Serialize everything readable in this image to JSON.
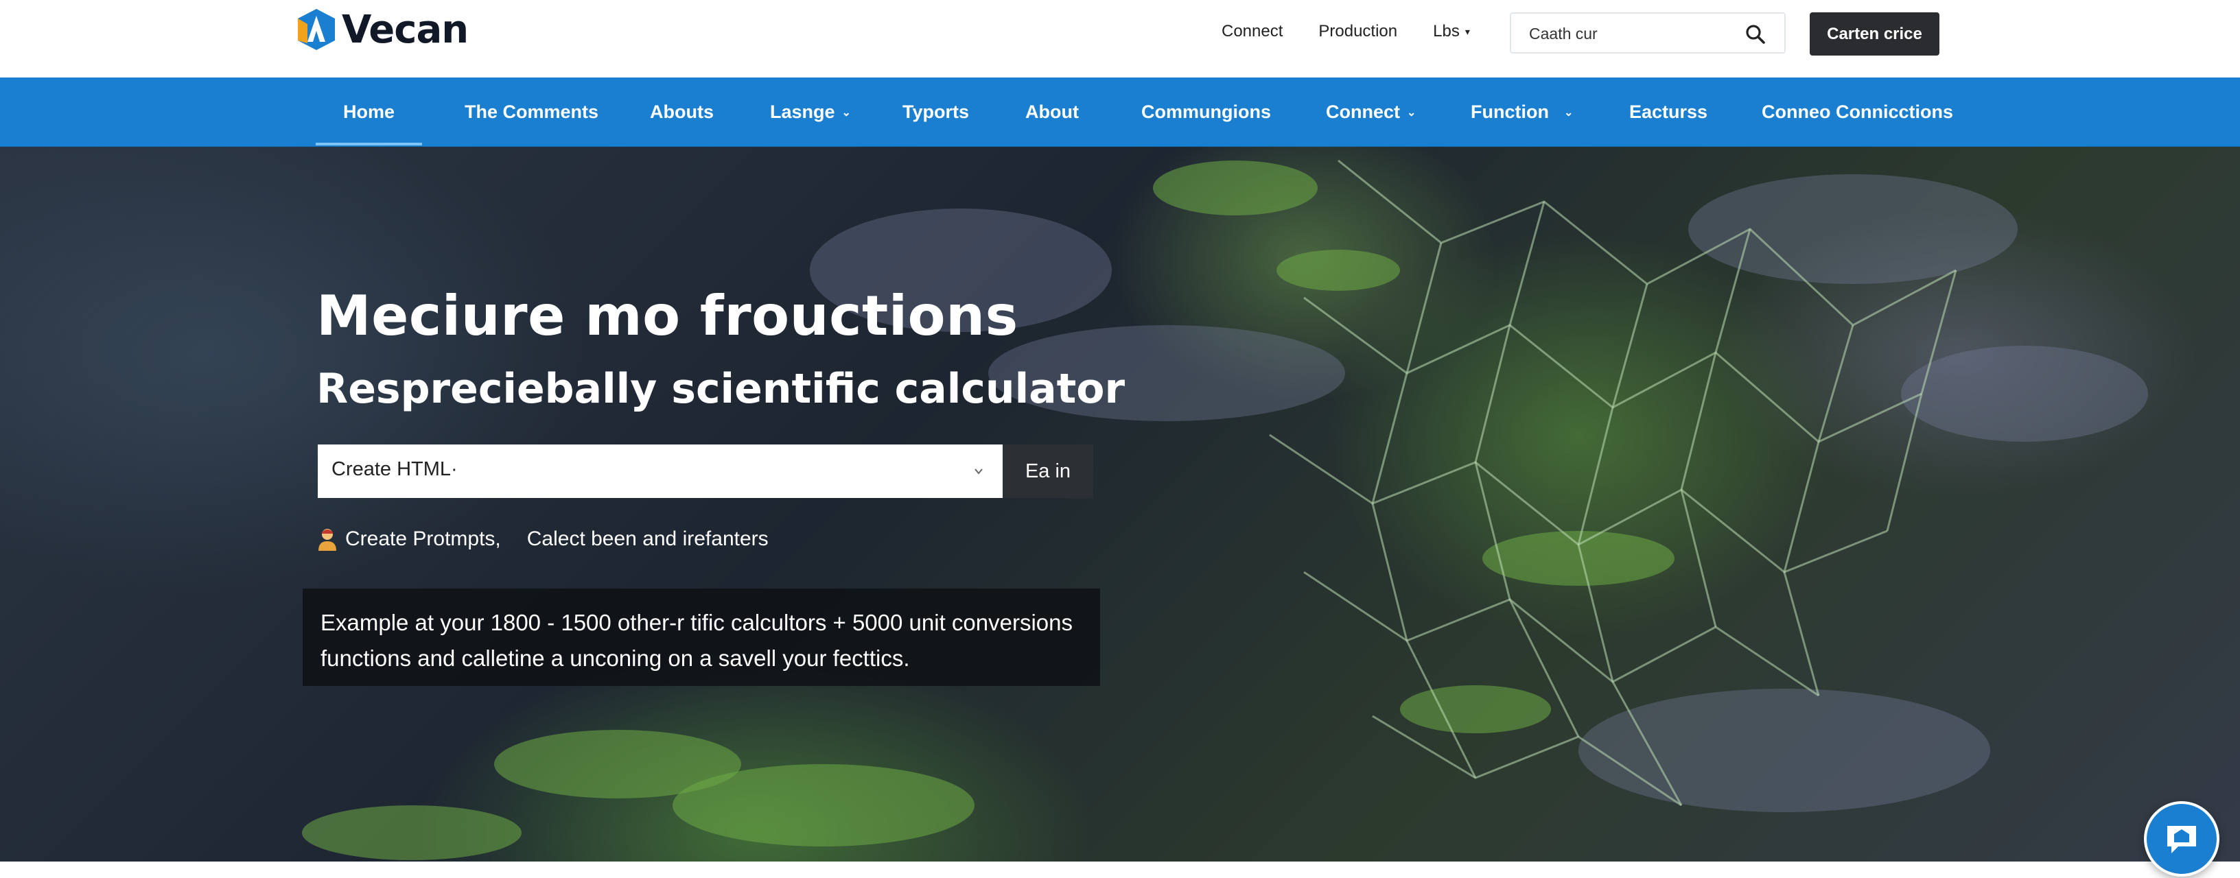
{
  "header": {
    "logo_text": "Vecan",
    "logo_colors": {
      "primary": "#1a7fd0",
      "accent": "#f3a21b"
    },
    "top_links": [
      {
        "label": "Connect",
        "has_dropdown": false
      },
      {
        "label": "Production",
        "has_dropdown": false
      },
      {
        "label": "Lbs",
        "has_dropdown": true
      }
    ],
    "search": {
      "value": "Caath cur",
      "icon": "search-icon"
    },
    "cta_label": "Carten crice"
  },
  "nav": {
    "background": "#1a7fd0",
    "items": [
      {
        "label": "Home",
        "active": true,
        "has_dropdown": false
      },
      {
        "label": "The Comments",
        "active": false,
        "has_dropdown": false
      },
      {
        "label": "Abouts",
        "active": false,
        "has_dropdown": false
      },
      {
        "label": "Lasnge",
        "active": false,
        "has_dropdown": true
      },
      {
        "label": "Tyports",
        "active": false,
        "has_dropdown": false
      },
      {
        "label": "About",
        "active": false,
        "has_dropdown": false
      },
      {
        "label": "Commungions",
        "active": false,
        "has_dropdown": false
      },
      {
        "label": "Connect",
        "active": false,
        "has_dropdown": true
      },
      {
        "label": "Function",
        "active": false,
        "has_dropdown": true
      },
      {
        "label": "Eacturss",
        "active": false,
        "has_dropdown": false
      },
      {
        "label": "Conneo Connicctions",
        "active": false,
        "has_dropdown": false
      }
    ]
  },
  "hero": {
    "title": "Meciure mo frouctions",
    "subtitle": "Respreciebally scientific calculator",
    "select": {
      "value": "Create HTML·",
      "icon": "chevron-down-icon"
    },
    "button_label": "Ea in",
    "hint": {
      "icon": "person-icon",
      "part1": "Create Protmpts,",
      "part2": "Calect been and irefanters"
    },
    "info_lines": [
      "Example at your 1800 - 1500 other-r tific calcultors + 5000 unit conversions",
      "functions and calletine a unconing on a savell your fecttics."
    ]
  },
  "chat": {
    "icon": "chat-bubble-icon"
  }
}
